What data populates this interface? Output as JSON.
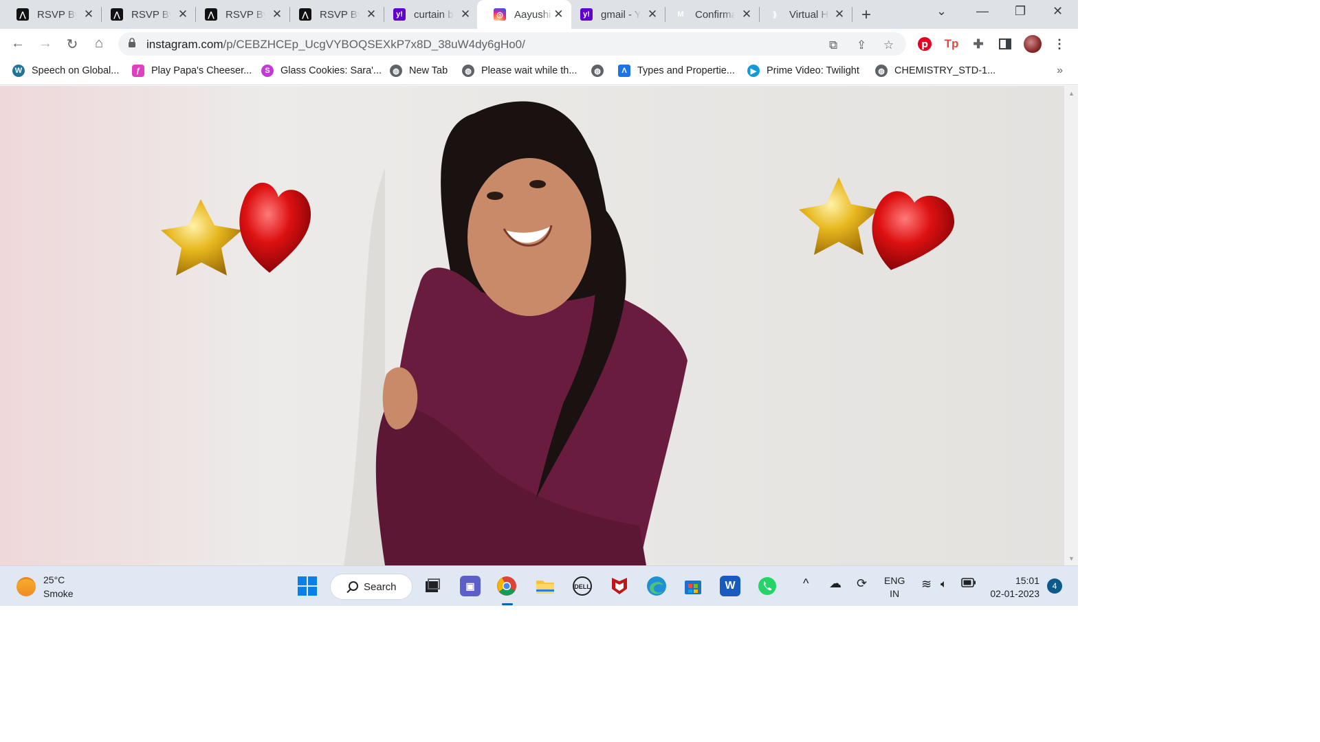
{
  "browser": {
    "tabs": [
      {
        "title": "RSVP By",
        "favicon": "rsvp-logo",
        "active": false
      },
      {
        "title": "RSVP By",
        "favicon": "rsvp-logo",
        "active": false
      },
      {
        "title": "RSVP By",
        "favicon": "rsvp-logo",
        "active": false
      },
      {
        "title": "RSVP By",
        "favicon": "rsvp-logo",
        "active": false
      },
      {
        "title": "curtain b",
        "favicon": "yahoo-logo",
        "active": false
      },
      {
        "title": "Aayushi",
        "favicon": "instagram-logo",
        "active": true
      },
      {
        "title": "gmail - Y",
        "favicon": "yahoo-logo",
        "active": false
      },
      {
        "title": "Confirma",
        "favicon": "gmail-logo",
        "active": false
      },
      {
        "title": "Virtual H",
        "favicon": "virtual-logo",
        "active": false
      }
    ],
    "url_host": "instagram.com",
    "url_path": "/p/CEBZHCEp_UcgVYBOQSEXkP7x8D_38uW4dy6gHo0/",
    "bookmarks": [
      {
        "label": "Speech on Global...",
        "icon": "wordpress-icon",
        "color": "#21759b"
      },
      {
        "label": "Play Papa's Cheeser...",
        "icon": "papas-icon",
        "color": "#e040c0"
      },
      {
        "label": "Glass Cookies: Sara'...",
        "icon": "s-icon",
        "color": "#c23bd6"
      },
      {
        "label": "New Tab",
        "icon": "globe-icon",
        "color": "#5f6368"
      },
      {
        "label": "Please wait while th...",
        "icon": "globe-icon",
        "color": "#5f6368"
      },
      {
        "label": "",
        "icon": "globe-icon",
        "color": "#5f6368"
      },
      {
        "label": "Types and Propertie...",
        "icon": "a-icon",
        "color": "#1a73e8"
      },
      {
        "label": "Prime Video: Twilight",
        "icon": "prime-video-icon",
        "color": "#1399d6"
      },
      {
        "label": "CHEMISTRY_STD-1...",
        "icon": "globe-icon",
        "color": "#5f6368"
      }
    ],
    "bookmarks_overflow": "»"
  },
  "taskbar": {
    "weather_temp": "25°C",
    "weather_desc": "Smoke",
    "search_label": "Search",
    "lang_top": "ENG",
    "lang_bottom": "IN",
    "time": "15:01",
    "date": "02-01-2023",
    "notification_count": "4"
  },
  "colors": {
    "tabstrip": "#dee1e6",
    "taskbar": "#dfe8f3",
    "pinterest": "#e60023",
    "sweater": "#6a1c3f",
    "balloon_gold": "#e0b31a",
    "balloon_red": "#d4121b"
  }
}
